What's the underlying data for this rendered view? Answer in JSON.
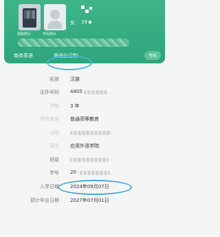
{
  "header": {
    "enroll_photo_caption": "录取照片",
    "student_photo_caption": "学历照片",
    "gender": "女",
    "dob_prefix": "19",
    "level": "专科",
    "major": "商务英语",
    "study_form": "普通全日制"
  },
  "fields": [
    {
      "label": "民族",
      "value": "汉族"
    },
    {
      "label": "证件号码",
      "value": "4405"
    },
    {
      "label": "学制",
      "value": "3 年"
    },
    {
      "label": "学历类别",
      "value": "普通高等教育"
    },
    {
      "label": "分院",
      "value": ""
    },
    {
      "label": "系所",
      "value": "应用外语学院"
    },
    {
      "label": "班级",
      "value": ""
    },
    {
      "label": "学号",
      "value": "20"
    },
    {
      "label": "入学日期",
      "value": "2024年09月07日"
    },
    {
      "label": "预计毕业日期",
      "value": "2027年07月01日"
    }
  ],
  "colors": {
    "header_green": "#2ea67b",
    "circle_blue": "#3fa8d6"
  }
}
